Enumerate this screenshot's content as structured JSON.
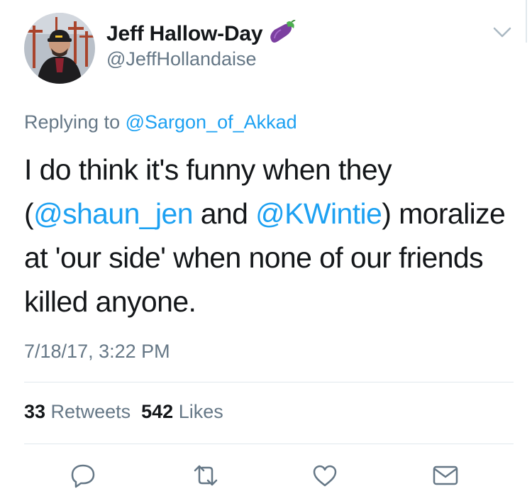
{
  "tweet": {
    "display_name": "Jeff Hallow-Day",
    "name_emoji_icon": "eggplant-icon",
    "handle": "@JeffHollandaise",
    "replying_prefix": "Replying to ",
    "replying_to": "@Sargon_of_Akkad",
    "text": {
      "part1": "I do think it's funny when they (",
      "mention1": "@shaun_jen",
      "part2": " and ",
      "mention2": "@KWintie",
      "part3": ") moralize at 'our side' when none of our friends killed anyone."
    },
    "timestamp": "7/18/17, 3:22 PM",
    "stats": {
      "retweet_count": "33",
      "retweet_label": " Retweets",
      "like_count": "542",
      "like_label": " Likes"
    },
    "actions": [
      "reply-icon",
      "retweet-icon",
      "like-icon",
      "direct-message-icon"
    ]
  },
  "colors": {
    "link": "#1da1f2",
    "secondary_text": "#657786",
    "primary_text": "#14171a",
    "divider": "#e1e8ed"
  }
}
